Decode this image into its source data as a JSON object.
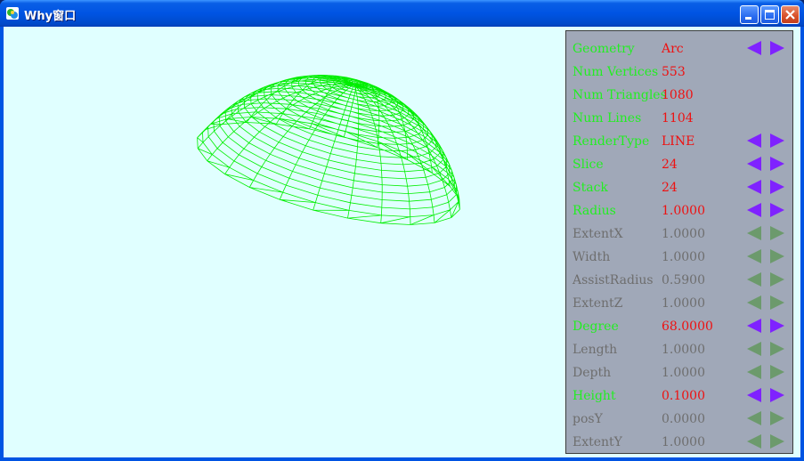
{
  "window": {
    "title": "Why窗口"
  },
  "colors": {
    "viewport_background": "#e0ffff",
    "mesh": "#00ee00",
    "panel_background": "#a0a8b8",
    "enabled_label": "#22ee22",
    "enabled_value": "#ee1111",
    "disabled_text": "#6e6e6e",
    "arrow_enabled": "#7f22ff",
    "arrow_disabled": "#6c9a6c"
  },
  "panel": {
    "rows": [
      {
        "label": "Geometry",
        "value": "Arc",
        "enabled": true,
        "arrows": true
      },
      {
        "label": "Num Vertices",
        "value": "553",
        "enabled": true,
        "arrows": false
      },
      {
        "label": "Num Triangles",
        "value": "1080",
        "enabled": true,
        "arrows": false
      },
      {
        "label": "Num Lines",
        "value": "1104",
        "enabled": true,
        "arrows": false
      },
      {
        "label": "RenderType",
        "value": "LINE",
        "enabled": true,
        "arrows": true
      },
      {
        "label": "Slice",
        "value": "24",
        "enabled": true,
        "arrows": true
      },
      {
        "label": "Stack",
        "value": "24",
        "enabled": true,
        "arrows": true
      },
      {
        "label": "Radius",
        "value": "1.0000",
        "enabled": true,
        "arrows": true
      },
      {
        "label": "ExtentX",
        "value": "1.0000",
        "enabled": false,
        "arrows": true
      },
      {
        "label": "Width",
        "value": "1.0000",
        "enabled": false,
        "arrows": true
      },
      {
        "label": "AssistRadius",
        "value": "0.5900",
        "enabled": false,
        "arrows": true
      },
      {
        "label": "ExtentZ",
        "value": "1.0000",
        "enabled": false,
        "arrows": true
      },
      {
        "label": "Degree",
        "value": "68.0000",
        "enabled": true,
        "arrows": true
      },
      {
        "label": "Length",
        "value": "1.0000",
        "enabled": false,
        "arrows": true
      },
      {
        "label": "Depth",
        "value": "1.0000",
        "enabled": false,
        "arrows": true
      },
      {
        "label": "Height",
        "value": "0.1000",
        "enabled": true,
        "arrows": true
      },
      {
        "label": "posY",
        "value": "0.0000",
        "enabled": false,
        "arrows": true
      },
      {
        "label": "ExtentY",
        "value": "1.0000",
        "enabled": false,
        "arrows": true
      }
    ]
  }
}
